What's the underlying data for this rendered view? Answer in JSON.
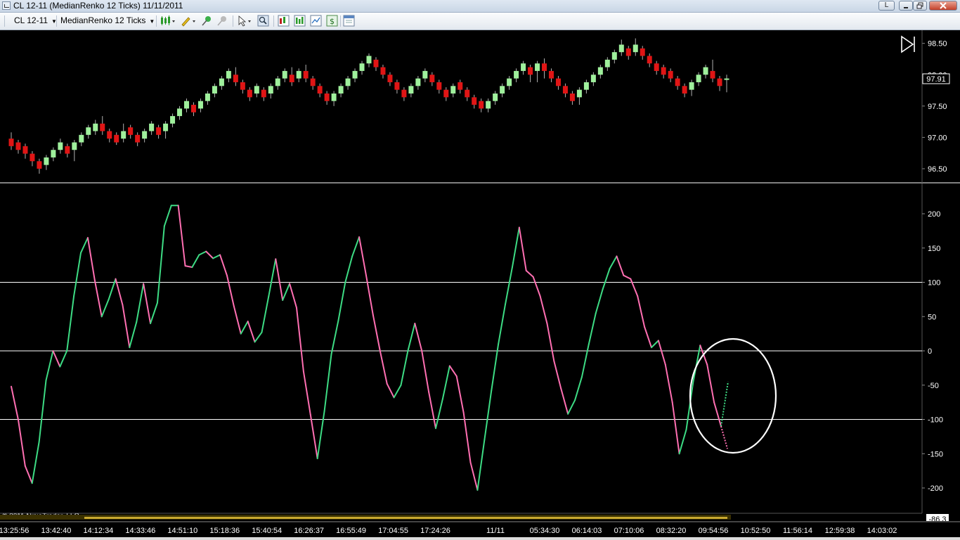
{
  "window": {
    "title": "CL 12-11 (MedianRenko 12 Ticks)  11/11/2011",
    "l_button": "L"
  },
  "toolbar": {
    "instrument": "CL 12-11",
    "period": "MedianRenko 12 Ticks"
  },
  "icons": [
    "bars-icon",
    "pencil-icon",
    "pin-icon",
    "pin-disabled-icon",
    "pointer-icon",
    "zoom-icon",
    "data-box-icon",
    "strategies-icon",
    "chart-properties-icon",
    "dollar-icon",
    "calendar-icon",
    "play-end-icon"
  ],
  "colors": {
    "up": "#9ff09c",
    "down": "#e01515",
    "osc_up": "#3ddc84",
    "osc_down": "#ff6fb2",
    "background": "#000000",
    "grid": "#ffffff"
  },
  "copyright": "© 2011 NinjaTrader, LLC",
  "price_panel": {
    "ticks": [
      "98.50",
      "98.00",
      "97.50",
      "97.00",
      "96.50"
    ],
    "last_price": "97.91"
  },
  "oscillator_panel": {
    "ticks": [
      "200",
      "150",
      "100",
      "50",
      "0",
      "-50",
      "-100",
      "-150",
      "-200"
    ],
    "last_value": "-86.3"
  },
  "time_axis": [
    "13:25:56",
    "13:42:40",
    "14:12:34",
    "14:33:46",
    "14:51:10",
    "15:18:36",
    "15:40:54",
    "16:26:37",
    "16:55:49",
    "17:04:55",
    "17:24:26",
    "11/11",
    "05:34:30",
    "06:14:03",
    "07:10:06",
    "08:32:20",
    "09:54:56",
    "10:52:50",
    "11:56:14",
    "12:59:38",
    "14:03:02"
  ],
  "chart_data": [
    {
      "type": "candlestick",
      "title": "CL 12-11 (MedianRenko 12 Ticks)",
      "ylim": [
        96.32,
        98.62
      ],
      "yticks": [
        98.5,
        98.0,
        97.5,
        97.0,
        96.5
      ],
      "last_price": 97.91,
      "bars": [
        {
          "o": 96.98,
          "c": 96.86,
          "h": 97.08,
          "l": 96.8
        },
        {
          "o": 96.92,
          "c": 96.8,
          "h": 96.96,
          "l": 96.74
        },
        {
          "o": 96.86,
          "c": 96.74,
          "h": 96.9,
          "l": 96.66
        },
        {
          "o": 96.74,
          "c": 96.62,
          "h": 96.78,
          "l": 96.54
        },
        {
          "o": 96.62,
          "c": 96.5,
          "h": 96.66,
          "l": 96.42
        },
        {
          "o": 96.56,
          "c": 96.68,
          "h": 96.72,
          "l": 96.48
        },
        {
          "o": 96.68,
          "c": 96.8,
          "h": 96.84,
          "l": 96.62
        },
        {
          "o": 96.8,
          "c": 96.92,
          "h": 96.98,
          "l": 96.74
        },
        {
          "o": 96.86,
          "c": 96.74,
          "h": 96.9,
          "l": 96.68
        },
        {
          "o": 96.8,
          "c": 96.92,
          "h": 96.96,
          "l": 96.62
        },
        {
          "o": 96.92,
          "c": 97.04,
          "h": 97.08,
          "l": 96.86
        },
        {
          "o": 97.04,
          "c": 97.16,
          "h": 97.2,
          "l": 96.98
        },
        {
          "o": 97.1,
          "c": 97.22,
          "h": 97.28,
          "l": 97.04
        },
        {
          "o": 97.22,
          "c": 97.1,
          "h": 97.34,
          "l": 97.04
        },
        {
          "o": 97.1,
          "c": 96.98,
          "h": 97.14,
          "l": 96.92
        },
        {
          "o": 97.04,
          "c": 96.92,
          "h": 97.08,
          "l": 96.88
        },
        {
          "o": 96.98,
          "c": 97.1,
          "h": 97.22,
          "l": 96.92
        },
        {
          "o": 97.16,
          "c": 97.04,
          "h": 97.2,
          "l": 96.98
        },
        {
          "o": 97.04,
          "c": 96.92,
          "h": 97.08,
          "l": 96.86
        },
        {
          "o": 96.98,
          "c": 97.1,
          "h": 97.14,
          "l": 96.92
        },
        {
          "o": 97.1,
          "c": 97.22,
          "h": 97.26,
          "l": 97.04
        },
        {
          "o": 97.16,
          "c": 97.04,
          "h": 97.2,
          "l": 96.98
        },
        {
          "o": 97.1,
          "c": 97.22,
          "h": 97.26,
          "l": 96.98
        },
        {
          "o": 97.22,
          "c": 97.34,
          "h": 97.38,
          "l": 97.16
        },
        {
          "o": 97.34,
          "c": 97.46,
          "h": 97.5,
          "l": 97.28
        },
        {
          "o": 97.46,
          "c": 97.58,
          "h": 97.62,
          "l": 97.4
        },
        {
          "o": 97.52,
          "c": 97.4,
          "h": 97.56,
          "l": 97.34
        },
        {
          "o": 97.46,
          "c": 97.58,
          "h": 97.62,
          "l": 97.4
        },
        {
          "o": 97.58,
          "c": 97.7,
          "h": 97.74,
          "l": 97.52
        },
        {
          "o": 97.7,
          "c": 97.82,
          "h": 97.86,
          "l": 97.64
        },
        {
          "o": 97.82,
          "c": 97.94,
          "h": 97.98,
          "l": 97.76
        },
        {
          "o": 97.94,
          "c": 98.06,
          "h": 98.1,
          "l": 97.88
        },
        {
          "o": 98.0,
          "c": 97.88,
          "h": 98.12,
          "l": 97.82
        },
        {
          "o": 97.88,
          "c": 97.76,
          "h": 97.92,
          "l": 97.7
        },
        {
          "o": 97.76,
          "c": 97.64,
          "h": 97.8,
          "l": 97.58
        },
        {
          "o": 97.7,
          "c": 97.82,
          "h": 97.86,
          "l": 97.64
        },
        {
          "o": 97.76,
          "c": 97.64,
          "h": 97.8,
          "l": 97.58
        },
        {
          "o": 97.7,
          "c": 97.82,
          "h": 97.86,
          "l": 97.62
        },
        {
          "o": 97.82,
          "c": 97.94,
          "h": 97.98,
          "l": 97.76
        },
        {
          "o": 97.94,
          "c": 98.06,
          "h": 98.1,
          "l": 97.88
        },
        {
          "o": 98.0,
          "c": 97.88,
          "h": 98.12,
          "l": 97.82
        },
        {
          "o": 97.94,
          "c": 98.06,
          "h": 98.1,
          "l": 97.88
        },
        {
          "o": 98.06,
          "c": 97.94,
          "h": 98.16,
          "l": 97.88
        },
        {
          "o": 97.94,
          "c": 97.82,
          "h": 97.98,
          "l": 97.76
        },
        {
          "o": 97.82,
          "c": 97.7,
          "h": 97.86,
          "l": 97.64
        },
        {
          "o": 97.7,
          "c": 97.58,
          "h": 97.74,
          "l": 97.52
        },
        {
          "o": 97.58,
          "c": 97.7,
          "h": 97.74,
          "l": 97.5
        },
        {
          "o": 97.7,
          "c": 97.82,
          "h": 97.86,
          "l": 97.64
        },
        {
          "o": 97.82,
          "c": 97.94,
          "h": 97.98,
          "l": 97.76
        },
        {
          "o": 97.94,
          "c": 98.06,
          "h": 98.1,
          "l": 97.88
        },
        {
          "o": 98.06,
          "c": 98.18,
          "h": 98.22,
          "l": 98.0
        },
        {
          "o": 98.18,
          "c": 98.3,
          "h": 98.34,
          "l": 98.12
        },
        {
          "o": 98.24,
          "c": 98.12,
          "h": 98.28,
          "l": 98.06
        },
        {
          "o": 98.12,
          "c": 98.0,
          "h": 98.16,
          "l": 97.94
        },
        {
          "o": 98.0,
          "c": 97.88,
          "h": 98.04,
          "l": 97.82
        },
        {
          "o": 97.88,
          "c": 97.76,
          "h": 97.92,
          "l": 97.7
        },
        {
          "o": 97.76,
          "c": 97.64,
          "h": 97.8,
          "l": 97.58
        },
        {
          "o": 97.7,
          "c": 97.82,
          "h": 97.86,
          "l": 97.64
        },
        {
          "o": 97.82,
          "c": 97.94,
          "h": 97.98,
          "l": 97.76
        },
        {
          "o": 97.94,
          "c": 98.06,
          "h": 98.1,
          "l": 97.88
        },
        {
          "o": 98.0,
          "c": 97.88,
          "h": 98.04,
          "l": 97.82
        },
        {
          "o": 97.88,
          "c": 97.76,
          "h": 97.92,
          "l": 97.7
        },
        {
          "o": 97.76,
          "c": 97.64,
          "h": 97.8,
          "l": 97.58
        },
        {
          "o": 97.7,
          "c": 97.82,
          "h": 97.86,
          "l": 97.64
        },
        {
          "o": 97.88,
          "c": 97.76,
          "h": 97.92,
          "l": 97.7
        },
        {
          "o": 97.76,
          "c": 97.64,
          "h": 97.8,
          "l": 97.58
        },
        {
          "o": 97.64,
          "c": 97.52,
          "h": 97.68,
          "l": 97.46
        },
        {
          "o": 97.58,
          "c": 97.46,
          "h": 97.62,
          "l": 97.4
        },
        {
          "o": 97.46,
          "c": 97.58,
          "h": 97.62,
          "l": 97.4
        },
        {
          "o": 97.58,
          "c": 97.7,
          "h": 97.74,
          "l": 97.52
        },
        {
          "o": 97.7,
          "c": 97.82,
          "h": 97.86,
          "l": 97.64
        },
        {
          "o": 97.82,
          "c": 97.94,
          "h": 97.98,
          "l": 97.76
        },
        {
          "o": 97.94,
          "c": 98.06,
          "h": 98.1,
          "l": 97.88
        },
        {
          "o": 98.06,
          "c": 98.18,
          "h": 98.22,
          "l": 98.0
        },
        {
          "o": 98.12,
          "c": 98.0,
          "h": 98.16,
          "l": 97.88
        },
        {
          "o": 98.06,
          "c": 98.18,
          "h": 98.22,
          "l": 97.88
        },
        {
          "o": 98.18,
          "c": 98.06,
          "h": 98.26,
          "l": 97.94
        },
        {
          "o": 98.06,
          "c": 97.94,
          "h": 98.1,
          "l": 97.88
        },
        {
          "o": 97.94,
          "c": 97.82,
          "h": 97.98,
          "l": 97.76
        },
        {
          "o": 97.82,
          "c": 97.7,
          "h": 97.86,
          "l": 97.64
        },
        {
          "o": 97.7,
          "c": 97.58,
          "h": 97.74,
          "l": 97.52
        },
        {
          "o": 97.64,
          "c": 97.76,
          "h": 97.8,
          "l": 97.52
        },
        {
          "o": 97.76,
          "c": 97.88,
          "h": 97.92,
          "l": 97.7
        },
        {
          "o": 97.88,
          "c": 98.0,
          "h": 98.04,
          "l": 97.82
        },
        {
          "o": 98.0,
          "c": 98.12,
          "h": 98.16,
          "l": 97.94
        },
        {
          "o": 98.12,
          "c": 98.24,
          "h": 98.28,
          "l": 98.06
        },
        {
          "o": 98.24,
          "c": 98.36,
          "h": 98.4,
          "l": 98.18
        },
        {
          "o": 98.36,
          "c": 98.48,
          "h": 98.56,
          "l": 98.3
        },
        {
          "o": 98.42,
          "c": 98.3,
          "h": 98.46,
          "l": 98.24
        },
        {
          "o": 98.36,
          "c": 98.48,
          "h": 98.58,
          "l": 98.3
        },
        {
          "o": 98.42,
          "c": 98.3,
          "h": 98.46,
          "l": 98.24
        },
        {
          "o": 98.3,
          "c": 98.18,
          "h": 98.34,
          "l": 98.12
        },
        {
          "o": 98.18,
          "c": 98.06,
          "h": 98.22,
          "l": 98.0
        },
        {
          "o": 98.12,
          "c": 98.0,
          "h": 98.16,
          "l": 97.94
        },
        {
          "o": 98.06,
          "c": 97.94,
          "h": 98.1,
          "l": 97.88
        },
        {
          "o": 97.94,
          "c": 97.82,
          "h": 97.98,
          "l": 97.76
        },
        {
          "o": 97.82,
          "c": 97.7,
          "h": 97.86,
          "l": 97.64
        },
        {
          "o": 97.76,
          "c": 97.88,
          "h": 97.92,
          "l": 97.66
        },
        {
          "o": 97.88,
          "c": 98.0,
          "h": 98.04,
          "l": 97.82
        },
        {
          "o": 98.0,
          "c": 98.12,
          "h": 98.16,
          "l": 97.94
        },
        {
          "o": 98.06,
          "c": 97.94,
          "h": 98.24,
          "l": 97.88
        },
        {
          "o": 97.94,
          "c": 97.82,
          "h": 97.98,
          "l": 97.74
        },
        {
          "o": 97.94,
          "c": 97.94,
          "h": 98.0,
          "l": 97.72
        }
      ]
    },
    {
      "type": "line",
      "title": "",
      "ylim": [
        -230,
        230
      ],
      "yticks": [
        200,
        150,
        100,
        50,
        0,
        -50,
        -100,
        -150,
        -200
      ],
      "gridlines": [
        100,
        0,
        -100
      ],
      "last_value": -86.3,
      "series": [
        {
          "values": [
            -52,
            -100,
            -168,
            -193,
            -133,
            -43,
            0,
            -23,
            0,
            80,
            143,
            165,
            103,
            50,
            75,
            105,
            67,
            5,
            42,
            98,
            40,
            70,
            182,
            212,
            212,
            124,
            122,
            140,
            145,
            135,
            140,
            110,
            65,
            25,
            43,
            13,
            27,
            80,
            134,
            74,
            98,
            63,
            -30,
            -93,
            -157,
            -88,
            -5,
            44,
            100,
            138,
            166,
            110,
            52,
            0,
            -48,
            -68,
            -50,
            0,
            40,
            0,
            -60,
            -113,
            -70,
            -22,
            -37,
            -90,
            -163,
            -203,
            -130,
            -58,
            10,
            68,
            122,
            180,
            117,
            108,
            80,
            40,
            -15,
            -55,
            -92,
            -72,
            -38,
            10,
            55,
            90,
            120,
            138,
            110,
            105,
            80,
            35,
            5,
            15,
            -20,
            -75,
            -150,
            -115,
            -45,
            8,
            -20,
            -75,
            -110
          ],
          "projection": [
            -75,
            -45
          ]
        }
      ]
    }
  ]
}
